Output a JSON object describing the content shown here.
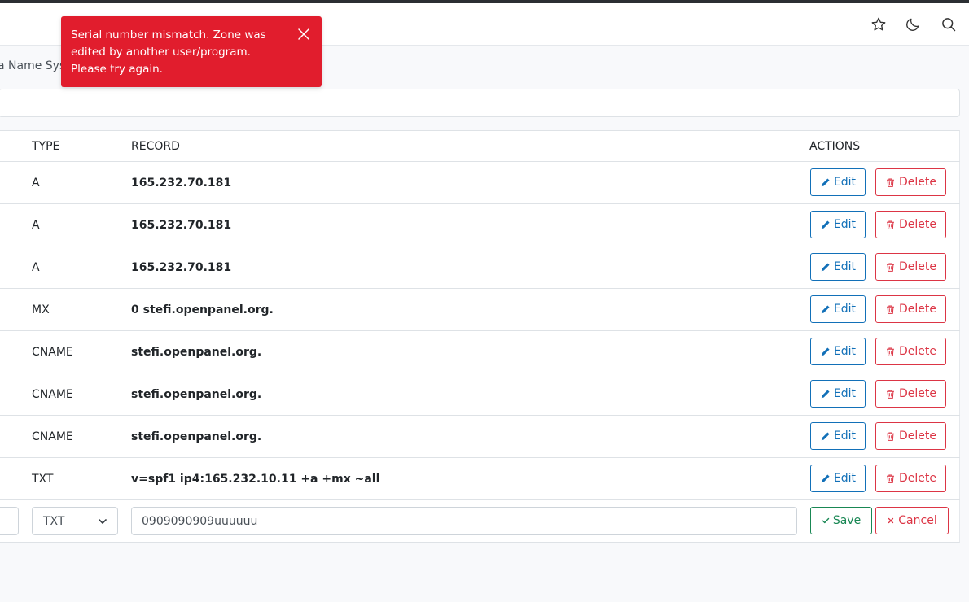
{
  "header": {
    "icons": [
      "star-icon",
      "moon-icon",
      "search-icon"
    ]
  },
  "breadcrumb": "a Name Syst",
  "toast": {
    "message": "Serial number mismatch. Zone was edited by another user/program. Please try again.",
    "color": "#e11d2d"
  },
  "table": {
    "headers": {
      "type": "TYPE",
      "record": "RECORD",
      "actions": "ACTIONS"
    },
    "rows": [
      {
        "type": "A",
        "record": "165.232.70.181"
      },
      {
        "type": "A",
        "record": "165.232.70.181"
      },
      {
        "type": "A",
        "record": "165.232.70.181"
      },
      {
        "type": "MX",
        "record": "0 stefi.openpanel.org."
      },
      {
        "type": "CNAME",
        "record": "stefi.openpanel.org."
      },
      {
        "type": "CNAME",
        "record": "stefi.openpanel.org."
      },
      {
        "type": "CNAME",
        "record": "stefi.openpanel.org."
      },
      {
        "type": "TXT",
        "record": "v=spf1 ip4:165.232.10.11 +a +mx ~all"
      }
    ],
    "edit_label": "Edit",
    "delete_label": "Delete",
    "edit_row": {
      "type_value": "TXT",
      "record_value": "0909090909uuuuuu",
      "save_label": "Save",
      "cancel_label": "Cancel"
    }
  },
  "colors": {
    "edit": "#1270b8",
    "delete": "#dc3545",
    "save": "#198754"
  }
}
